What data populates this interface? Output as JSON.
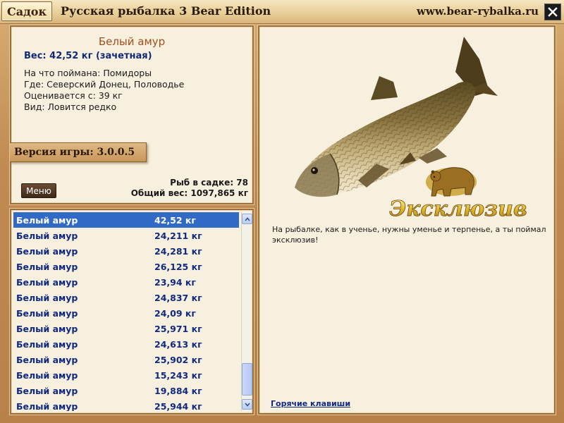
{
  "titlebar": {
    "sadok_label": "Садок",
    "title": "Русская рыбалка 3 Bear Edition",
    "site": "www.bear-rybalka.ru",
    "close_icon": "close-icon"
  },
  "info": {
    "fish_name": "Белый амур",
    "weight_line": "Вес: 42,52 кг (зачетная)",
    "bait_line": "На что поймана: Помидоры",
    "place_line": "Где: Северский Донец, Половодье",
    "value_line": "Оценивается с: 39 кг",
    "kind_line": "Вид: Ловится редко",
    "version_label": "Версия игры: 3.0.0.5",
    "menu_label": "Меню",
    "fish_count": "Рыб в садке: 78",
    "total_weight": "Общий вес: 1097,865 кг"
  },
  "catch_list": {
    "rows": [
      {
        "name": "Белый амур",
        "weight": "42,52 кг"
      },
      {
        "name": "Белый амур",
        "weight": "24,211 кг"
      },
      {
        "name": "Белый амур",
        "weight": "24,281 кг"
      },
      {
        "name": "Белый амур",
        "weight": "26,125 кг"
      },
      {
        "name": "Белый амур",
        "weight": "23,94 кг"
      },
      {
        "name": "Белый амур",
        "weight": "24,837 кг"
      },
      {
        "name": "Белый амур",
        "weight": "24,09 кг"
      },
      {
        "name": "Белый амур",
        "weight": "25,971 кг"
      },
      {
        "name": "Белый амур",
        "weight": "24,613 кг"
      },
      {
        "name": "Белый амур",
        "weight": "25,902 кг"
      },
      {
        "name": "Белый амур",
        "weight": "15,243 кг"
      },
      {
        "name": "Белый амур",
        "weight": "19,884 кг"
      },
      {
        "name": "Белый амур",
        "weight": "25,944 кг"
      }
    ],
    "selected_index": 0
  },
  "detail": {
    "exclusive_label": "Эксклюзив",
    "message": "На рыбалке, как в ученье, нужны уменье и терпенье, а ты поймал эксклюзив!",
    "hotkeys_label": "Горячие клавиши"
  },
  "colors": {
    "frame": "#c08a52",
    "panel": "#f8f0de",
    "selection": "#3169c6",
    "list_text": "#0f2a80",
    "fish_name": "#a0501d"
  }
}
